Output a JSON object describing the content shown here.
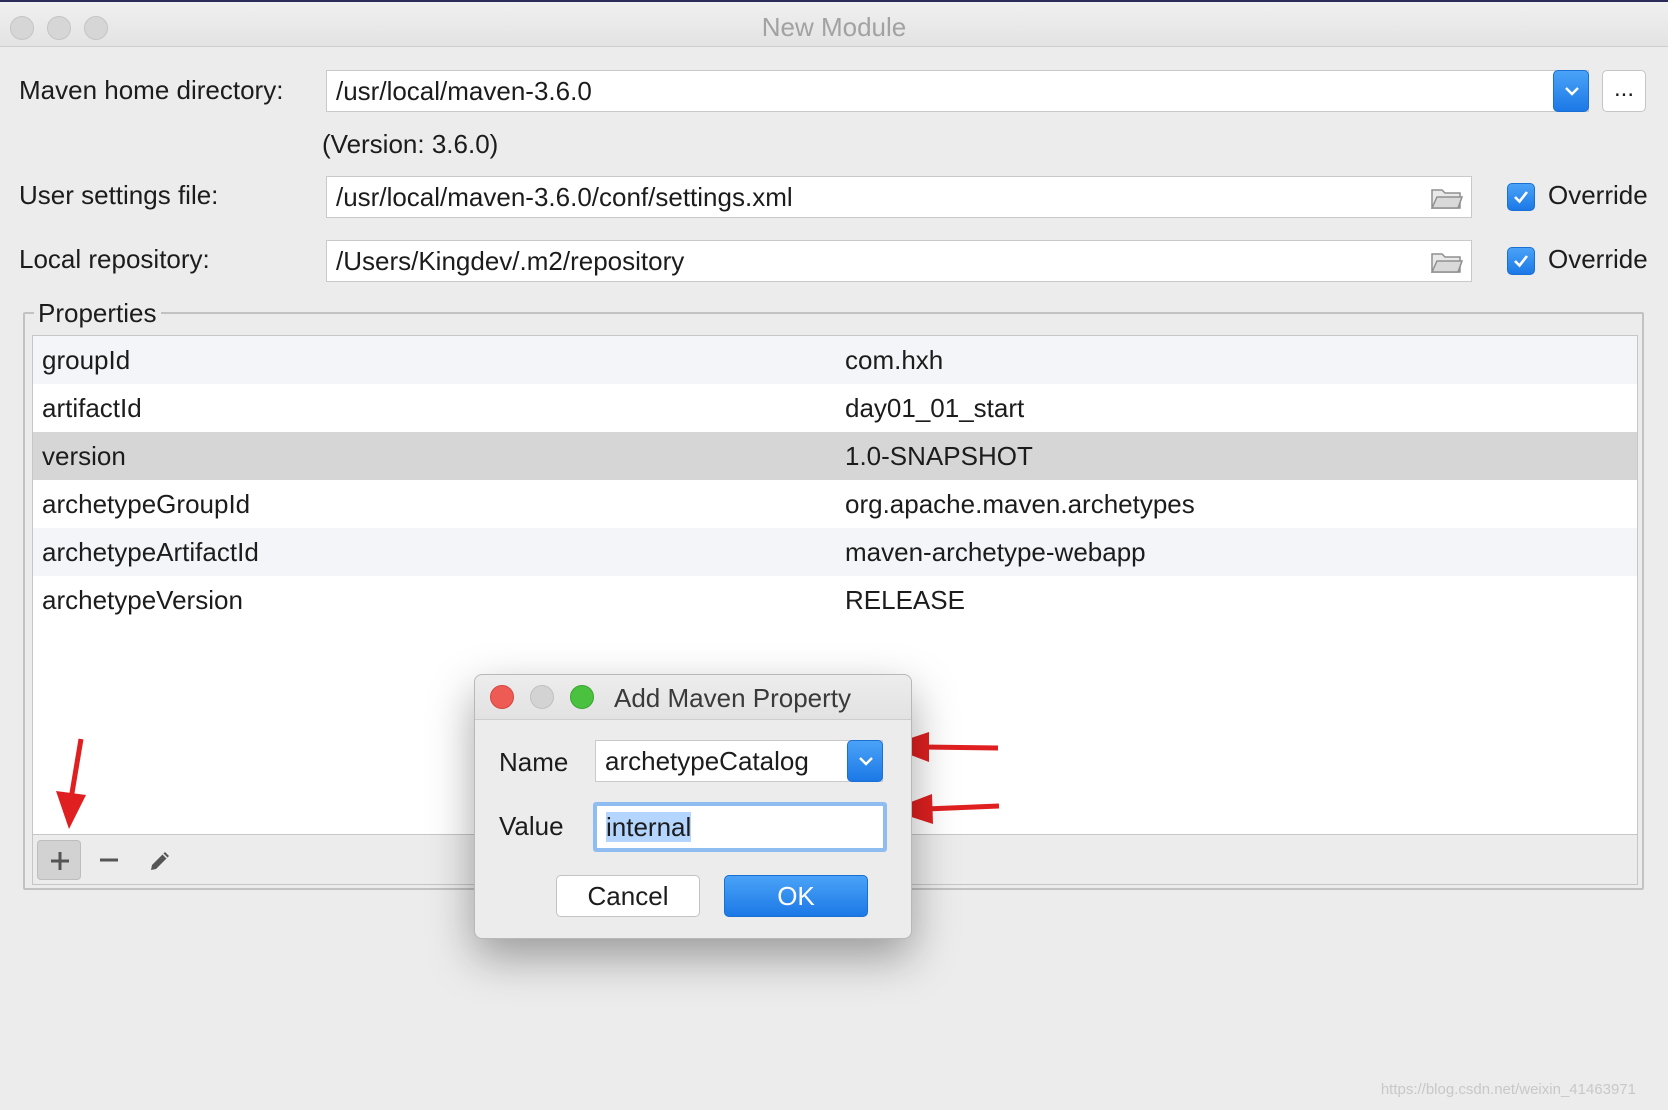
{
  "window": {
    "title": "New Module"
  },
  "maven": {
    "home_label": "Maven home directory:",
    "home_value": "/usr/local/maven-3.6.0",
    "version_note": "(Version: 3.6.0)",
    "browse_label": "...",
    "settings_label": "User settings file:",
    "settings_value": "/usr/local/maven-3.6.0/conf/settings.xml",
    "settings_override": "Override",
    "repo_label": "Local repository:",
    "repo_value": "/Users/Kingdev/.m2/repository",
    "repo_override": "Override"
  },
  "properties": {
    "title": "Properties",
    "rows": [
      {
        "key": "groupId",
        "value": "com.hxh"
      },
      {
        "key": "artifactId",
        "value": "day01_01_start"
      },
      {
        "key": "version",
        "value": "1.0-SNAPSHOT"
      },
      {
        "key": "archetypeGroupId",
        "value": "org.apache.maven.archetypes"
      },
      {
        "key": "archetypeArtifactId",
        "value": "maven-archetype-webapp"
      },
      {
        "key": "archetypeVersion",
        "value": "RELEASE"
      }
    ]
  },
  "dialog": {
    "title": "Add Maven Property",
    "name_label": "Name",
    "name_value": "archetypeCatalog",
    "value_label": "Value",
    "value_value": "internal",
    "cancel_label": "Cancel",
    "ok_label": "OK"
  },
  "watermark": "https://blog.csdn.net/weixin_41463971",
  "colors": {
    "accent": "#1c78e6",
    "arrow": "#e02020",
    "selected_row": "#d6d6d6"
  }
}
